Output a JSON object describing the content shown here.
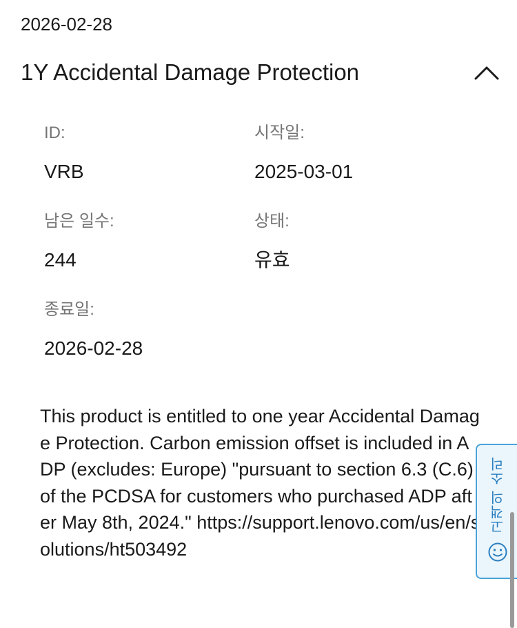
{
  "top_date": "2026-02-28",
  "warranty": {
    "title": "1Y Accidental Damage Protection",
    "fields": {
      "id": {
        "label": "ID:",
        "value": "VRB"
      },
      "start_date": {
        "label": "시작일:",
        "value": "2025-03-01"
      },
      "remaining_days": {
        "label": "남은 일수:",
        "value": "244"
      },
      "status": {
        "label": "상태:",
        "value": "유효"
      },
      "end_date": {
        "label": "종료일:",
        "value": "2026-02-28"
      }
    },
    "description": "This product is entitled to one year Accidental Damage Protection. Carbon emission offset is included in ADP (excludes: Europe) \"pursuant to section 6.3 (C.6) of the PCDSA for customers who purchased ADP after May 8th, 2024.\" https://support.lenovo.com/us/en/solutions/ht503492"
  },
  "feedback_tab": {
    "label": "고객의 소리",
    "icon": "smiley-icon",
    "color": "#4aa3d8"
  },
  "icons": {
    "collapse": "chevron-up-icon"
  }
}
